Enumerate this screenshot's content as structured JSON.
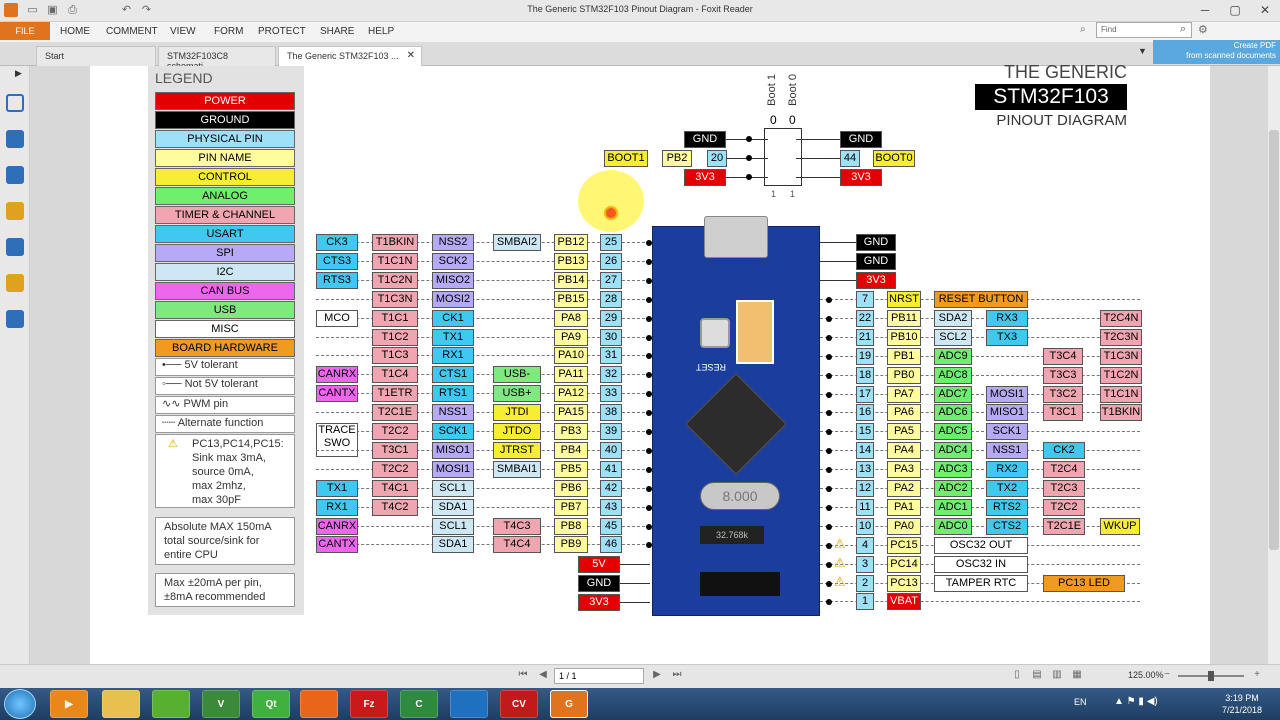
{
  "window": {
    "title": "The Generic STM32F103 Pinout Diagram - Foxit Reader"
  },
  "menu": {
    "file": "FILE",
    "items": [
      "HOME",
      "COMMENT",
      "VIEW",
      "FORM",
      "PROTECT",
      "SHARE",
      "HELP"
    ]
  },
  "search": {
    "placeholder": "Find"
  },
  "tabs": [
    "Start",
    "STM32F103C8 schemati...",
    "The Generic STM32F103 ..."
  ],
  "createpdf": "Create PDF\nfrom scanned documents",
  "status": {
    "page": "1 / 1",
    "zoom": "125.00%"
  },
  "taskbar": {
    "lang": "EN",
    "time": "3:19 PM",
    "date": "7/21/2018"
  },
  "diagram": {
    "title1": "THE GENERIC",
    "title2": "STM32F103",
    "title3": "PINOUT DIAGRAM",
    "boot1": "Boot 1",
    "boot0": "Boot 0",
    "n0a": "0",
    "n0b": "0",
    "n1a": "1",
    "n1b": "1"
  },
  "legend": {
    "title": "LEGEND",
    "items": [
      "POWER",
      "GROUND",
      "PHYSICAL PIN",
      "PIN NAME",
      "CONTROL",
      "ANALOG",
      "TIMER & CHANNEL",
      "USART",
      "SPI",
      "I2C",
      "CAN BUS",
      "USB",
      "MISC",
      "BOARD HARDWARE"
    ],
    "tol5": "5V tolerant",
    "not5": "Not 5V tolerant",
    "pwm": "PWM pin",
    "alt": "Alternate function",
    "warn": "PC13,PC14,PC15:\nSink max 3mA,\nsource 0mA,\nmax 2mhz,\nmax 30pF",
    "absmax": "Absolute MAX 150mA\ntotal source/sink for\nentire CPU",
    "maxpin": "Max ±20mA per pin,\n±8mA recommended"
  },
  "board": {
    "reset": "RESET",
    "crystal": "8.000",
    "rtc": "32.768k"
  },
  "left_rows": [
    {
      "c": [
        "CK3",
        "T1BKIN",
        "NSS2",
        "SMBAI2"
      ],
      "pin": "PB12",
      "num": "25"
    },
    {
      "c": [
        "CTS3",
        "T1C1N",
        "SCK2",
        ""
      ],
      "pin": "PB13",
      "num": "26"
    },
    {
      "c": [
        "RTS3",
        "T1C2N",
        "MISO2",
        ""
      ],
      "pin": "PB14",
      "num": "27"
    },
    {
      "c": [
        "",
        "T1C3N",
        "MOSI2",
        ""
      ],
      "pin": "PB15",
      "num": "28"
    },
    {
      "c": [
        "MCO",
        "T1C1",
        "CK1",
        ""
      ],
      "pin": "PA8",
      "num": "29"
    },
    {
      "c": [
        "",
        "T1C2",
        "TX1",
        ""
      ],
      "pin": "PA9",
      "num": "30"
    },
    {
      "c": [
        "",
        "T1C3",
        "RX1",
        ""
      ],
      "pin": "PA10",
      "num": "31"
    },
    {
      "c": [
        "CANRX",
        "T1C4",
        "CTS1",
        "USB-"
      ],
      "pin": "PA11",
      "num": "32"
    },
    {
      "c": [
        "CANTX",
        "T1ETR",
        "RTS1",
        "USB+"
      ],
      "pin": "PA12",
      "num": "33"
    },
    {
      "c": [
        "",
        "T2C1E",
        "NSS1",
        "JTDI"
      ],
      "pin": "PA15",
      "num": "38"
    },
    {
      "c": [
        "TRACE\nSWO",
        "T2C2",
        "SCK1",
        "JTDO"
      ],
      "pin": "PB3",
      "num": "39"
    },
    {
      "c": [
        "",
        "T3C1",
        "MISO1",
        "JTRST"
      ],
      "pin": "PB4",
      "num": "40"
    },
    {
      "c": [
        "",
        "T2C2",
        "MOSI1",
        "SMBAI1"
      ],
      "pin": "PB5",
      "num": "41"
    },
    {
      "c": [
        "TX1",
        "T4C1",
        "SCL1",
        ""
      ],
      "pin": "PB6",
      "num": "42"
    },
    {
      "c": [
        "RX1",
        "T4C2",
        "SDA1",
        ""
      ],
      "pin": "PB7",
      "num": "43"
    },
    {
      "c": [
        "CANRX",
        "",
        "SCL1",
        "T4C3"
      ],
      "pin": "PB8",
      "num": "45"
    },
    {
      "c": [
        "CANTX",
        "",
        "SDA1",
        "T4C4"
      ],
      "pin": "PB9",
      "num": "46"
    }
  ],
  "left_bottom": [
    "5V",
    "GND",
    "3V3"
  ],
  "top_left": {
    "gnd": "GND",
    "pin": "PB2",
    "num": "20",
    "boot": "BOOT1",
    "v": "3V3"
  },
  "top_right": {
    "gnd": "GND",
    "num": "44",
    "boot": "BOOT0",
    "v": "3V3"
  },
  "right_top": [
    "GND",
    "GND",
    "3V3"
  ],
  "right_rows": [
    {
      "num": "7",
      "pin": "NRST",
      "c": [
        "RESET BUTTON"
      ]
    },
    {
      "num": "22",
      "pin": "PB11",
      "c": [
        "SDA2",
        "RX3",
        "",
        "",
        "T2C4N"
      ]
    },
    {
      "num": "21",
      "pin": "PB10",
      "c": [
        "SCL2",
        "TX3",
        "",
        "",
        "T2C3N"
      ]
    },
    {
      "num": "19",
      "pin": "PB1",
      "c": [
        "ADC9",
        "",
        "",
        "T3C4",
        "T1C3N"
      ]
    },
    {
      "num": "18",
      "pin": "PB0",
      "c": [
        "ADC8",
        "",
        "",
        "T3C3",
        "T1C2N"
      ]
    },
    {
      "num": "17",
      "pin": "PA7",
      "c": [
        "ADC7",
        "MOSI1",
        "",
        "T3C2",
        "T1C1N"
      ]
    },
    {
      "num": "16",
      "pin": "PA6",
      "c": [
        "ADC6",
        "MISO1",
        "",
        "T3C1",
        "T1BKIN"
      ]
    },
    {
      "num": "15",
      "pin": "PA5",
      "c": [
        "ADC5",
        "SCK1",
        "",
        "",
        ""
      ]
    },
    {
      "num": "14",
      "pin": "PA4",
      "c": [
        "ADC4",
        "NSS1",
        "CK2",
        "",
        ""
      ]
    },
    {
      "num": "13",
      "pin": "PA3",
      "c": [
        "ADC3",
        "RX2",
        "T2C4",
        "",
        ""
      ]
    },
    {
      "num": "12",
      "pin": "PA2",
      "c": [
        "ADC2",
        "TX2",
        "T2C3",
        "",
        ""
      ]
    },
    {
      "num": "11",
      "pin": "PA1",
      "c": [
        "ADC1",
        "RTS2",
        "T2C2",
        "",
        ""
      ]
    },
    {
      "num": "10",
      "pin": "PA0",
      "c": [
        "ADC0",
        "CTS2",
        "T2C1E",
        "WKUP",
        ""
      ]
    },
    {
      "num": "4",
      "pin": "PC15",
      "c": [
        "OSC32 OUT"
      ]
    },
    {
      "num": "3",
      "pin": "PC14",
      "c": [
        "OSC32 IN"
      ]
    },
    {
      "num": "2",
      "pin": "PC13",
      "c": [
        "TAMPER RTC",
        "PC13 LED"
      ]
    },
    {
      "num": "1",
      "pin": "VBAT",
      "c": []
    }
  ]
}
